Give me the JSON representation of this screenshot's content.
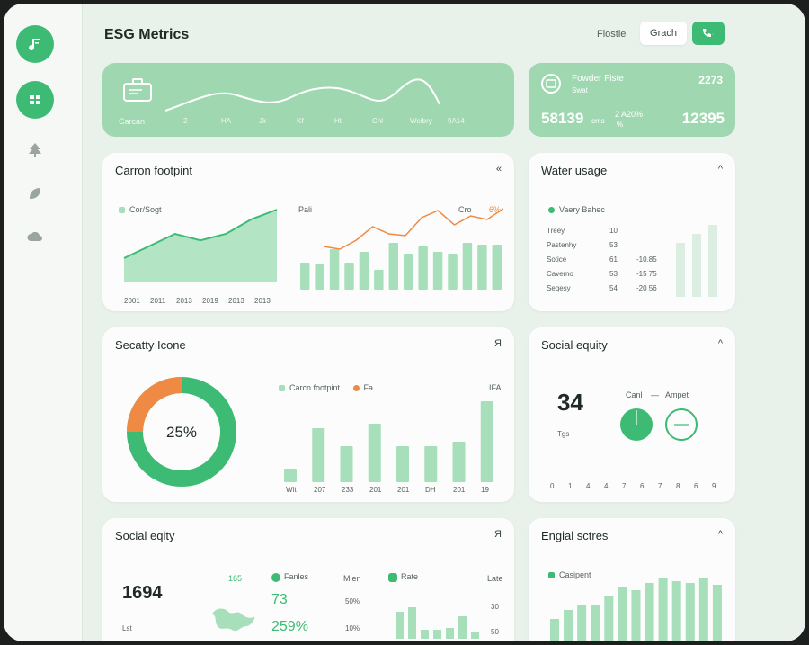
{
  "header": {
    "title": "ESG Metrics",
    "profile_label": "Flostie",
    "search_label": "Grach"
  },
  "hero_left": {
    "label": "Carcan",
    "x_labels": [
      "2",
      "HA",
      "Jk",
      "Kf",
      "Ht",
      "Chl",
      "Weibry",
      "9A14"
    ]
  },
  "hero_right": {
    "title": "Fowder Fiste",
    "subtitle": "Swat",
    "value_top": "2273",
    "value1": "58139",
    "value1_suffix": "cms",
    "value2": "2 A20%",
    "value2_sub": "%",
    "value3": "12395"
  },
  "carbon_card": {
    "title": "Carron footpint",
    "menu": "«",
    "legend": "Cor/Sogt",
    "x_labels": [
      "2001",
      "2011",
      "2013",
      "2019",
      "2013",
      "2013"
    ],
    "sublabel_left": "Pali",
    "sublabel_right": "Cro",
    "sublabel_pct": "6%",
    "line_values": [
      30,
      45,
      60,
      52,
      60,
      78,
      90
    ],
    "bar_values": [
      30,
      28,
      45,
      30,
      42,
      22,
      52,
      40,
      48,
      42,
      40,
      52,
      50,
      50
    ],
    "orange_values": [
      48,
      45,
      55,
      70,
      62,
      60,
      80,
      88,
      72,
      82,
      78,
      90
    ]
  },
  "water_card": {
    "title": "Water usage",
    "menu": "^",
    "legend": "Vaery Bahec",
    "rows": [
      {
        "label": "Treey",
        "v1": "10",
        "v2": ""
      },
      {
        "label": "Pastenhy",
        "v1": "53",
        "v2": ""
      },
      {
        "label": "Sotice",
        "v1": "61",
        "v2": "-10.85"
      },
      {
        "label": "Cavemo",
        "v1": "53",
        "v2": "-15 75"
      },
      {
        "label": "Seqesy",
        "v1": "54",
        "v2": "-20 56"
      }
    ],
    "bar_values": [
      60,
      70,
      80
    ]
  },
  "security_card": {
    "title": "Secatty Icone",
    "menu": "Я",
    "donut_center": "25%",
    "donut_fraction": 0.25,
    "legend_green": "Carcn footpint",
    "legend_orange": "Fa",
    "top_right": "IFA",
    "x_labels": [
      "Wit",
      "207",
      "233",
      "201",
      "201",
      "DH",
      "201",
      "19"
    ],
    "bar_values": [
      15,
      60,
      40,
      65,
      40,
      40,
      45,
      90
    ]
  },
  "social_equity_card": {
    "title": "Social equity",
    "menu": "^",
    "big_number": "34",
    "big_sub": "Tgs",
    "label_left": "Canl",
    "label_right": "Ampet",
    "scale": [
      "0",
      "1",
      "4",
      "4",
      "7",
      "6",
      "7",
      "8",
      "6",
      "9"
    ]
  },
  "social_bottom_card": {
    "title": "Social eqity",
    "menu": "Я",
    "big_number": "1694",
    "big_sub": "Lst",
    "col1": "165",
    "legend_fanles": "Fanles",
    "label_mlen": "Mlen",
    "legend_rate": "Rate",
    "label_late": "Late",
    "value1": "73",
    "value2": "259%",
    "pct1": "50%",
    "pct2": "10%",
    "right1": "30",
    "right2": "50",
    "bar_values": [
      30,
      35,
      10,
      10,
      12,
      25,
      8
    ]
  },
  "energy_card": {
    "title": "Engial sctres",
    "menu": "^",
    "legend": "Casipent",
    "bar_values": [
      30,
      40,
      45,
      45,
      55,
      65,
      62,
      70,
      75,
      72,
      70,
      75,
      68
    ]
  },
  "colors": {
    "green": "#3dbb74",
    "light_green": "#a6dfba",
    "orange": "#ef8a45",
    "hero": "#9fd8b0"
  }
}
